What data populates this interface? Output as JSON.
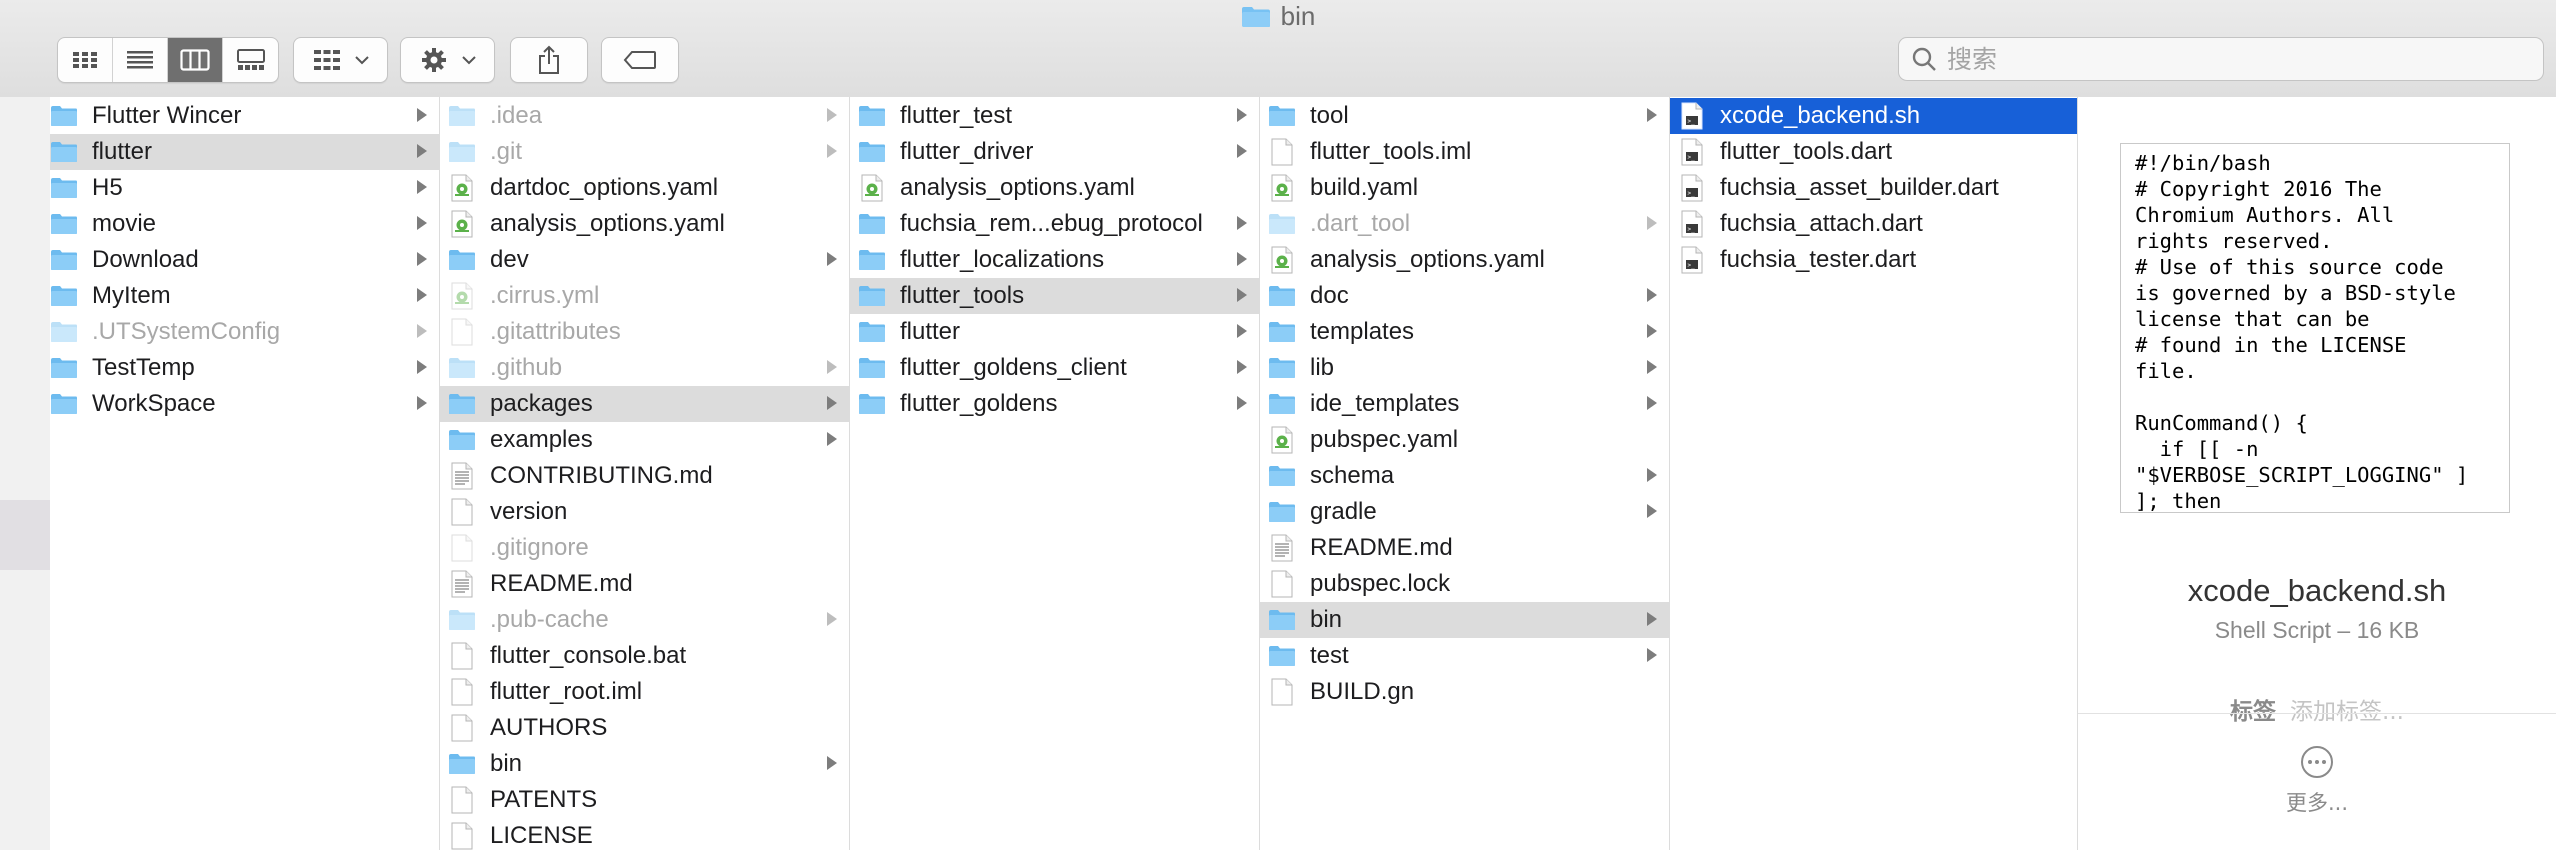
{
  "window": {
    "title": "bin"
  },
  "toolbar": {
    "view_modes": [
      {
        "id": "icon",
        "active": false
      },
      {
        "id": "list",
        "active": false
      },
      {
        "id": "column",
        "active": true
      },
      {
        "id": "gallery",
        "active": false
      }
    ],
    "search": {
      "placeholder": "搜索",
      "value": ""
    }
  },
  "columns": [
    {
      "items": [
        {
          "label": "Flutter Wincer",
          "type": "folder",
          "arrow": true
        },
        {
          "label": "flutter",
          "type": "folder",
          "arrow": true,
          "selected": "grey"
        },
        {
          "label": "H5",
          "type": "folder",
          "arrow": true
        },
        {
          "label": "movie",
          "type": "folder",
          "arrow": true
        },
        {
          "label": "Download",
          "type": "folder",
          "arrow": true
        },
        {
          "label": "MyItem",
          "type": "folder",
          "arrow": true
        },
        {
          "label": ".UTSystemConfig",
          "type": "folder",
          "arrow": true,
          "dim": true
        },
        {
          "label": "TestTemp",
          "type": "folder",
          "arrow": true
        },
        {
          "label": "WorkSpace",
          "type": "folder",
          "arrow": true
        }
      ]
    },
    {
      "items": [
        {
          "label": ".idea",
          "type": "folder",
          "arrow": true,
          "dim": true
        },
        {
          "label": ".git",
          "type": "folder",
          "arrow": true,
          "dim": true
        },
        {
          "label": "dartdoc_options.yaml",
          "type": "yaml"
        },
        {
          "label": "analysis_options.yaml",
          "type": "yaml"
        },
        {
          "label": "dev",
          "type": "folder",
          "arrow": true
        },
        {
          "label": ".cirrus.yml",
          "type": "yaml",
          "dim": true
        },
        {
          "label": ".gitattributes",
          "type": "doc",
          "dim": true
        },
        {
          "label": ".github",
          "type": "folder",
          "arrow": true,
          "dim": true
        },
        {
          "label": "packages",
          "type": "folder",
          "arrow": true,
          "selected": "grey"
        },
        {
          "label": "examples",
          "type": "folder",
          "arrow": true
        },
        {
          "label": "CONTRIBUTING.md",
          "type": "text"
        },
        {
          "label": "version",
          "type": "doc"
        },
        {
          "label": ".gitignore",
          "type": "doc",
          "dim": true
        },
        {
          "label": "README.md",
          "type": "text"
        },
        {
          "label": ".pub-cache",
          "type": "folder",
          "arrow": true,
          "dim": true
        },
        {
          "label": "flutter_console.bat",
          "type": "doc"
        },
        {
          "label": "flutter_root.iml",
          "type": "doc"
        },
        {
          "label": "AUTHORS",
          "type": "doc"
        },
        {
          "label": "bin",
          "type": "folder",
          "arrow": true
        },
        {
          "label": "PATENTS",
          "type": "doc"
        },
        {
          "label": "LICENSE",
          "type": "doc"
        }
      ]
    },
    {
      "items": [
        {
          "label": "flutter_test",
          "type": "folder",
          "arrow": true
        },
        {
          "label": "flutter_driver",
          "type": "folder",
          "arrow": true
        },
        {
          "label": "analysis_options.yaml",
          "type": "yaml"
        },
        {
          "label": "fuchsia_rem...ebug_protocol",
          "type": "folder",
          "arrow": true
        },
        {
          "label": "flutter_localizations",
          "type": "folder",
          "arrow": true
        },
        {
          "label": "flutter_tools",
          "type": "folder",
          "arrow": true,
          "selected": "grey"
        },
        {
          "label": "flutter",
          "type": "folder",
          "arrow": true
        },
        {
          "label": "flutter_goldens_client",
          "type": "folder",
          "arrow": true
        },
        {
          "label": "flutter_goldens",
          "type": "folder",
          "arrow": true
        }
      ]
    },
    {
      "items": [
        {
          "label": "tool",
          "type": "folder",
          "arrow": true
        },
        {
          "label": "flutter_tools.iml",
          "type": "doc"
        },
        {
          "label": "build.yaml",
          "type": "yaml"
        },
        {
          "label": ".dart_tool",
          "type": "folder",
          "arrow": true,
          "dim": true
        },
        {
          "label": "analysis_options.yaml",
          "type": "yaml"
        },
        {
          "label": "doc",
          "type": "folder",
          "arrow": true
        },
        {
          "label": "templates",
          "type": "folder",
          "arrow": true
        },
        {
          "label": "lib",
          "type": "folder",
          "arrow": true
        },
        {
          "label": "ide_templates",
          "type": "folder",
          "arrow": true
        },
        {
          "label": "pubspec.yaml",
          "type": "yaml"
        },
        {
          "label": "schema",
          "type": "folder",
          "arrow": true
        },
        {
          "label": "gradle",
          "type": "folder",
          "arrow": true
        },
        {
          "label": "README.md",
          "type": "text"
        },
        {
          "label": "pubspec.lock",
          "type": "doc"
        },
        {
          "label": "bin",
          "type": "folder",
          "arrow": true,
          "selected": "grey"
        },
        {
          "label": "test",
          "type": "folder",
          "arrow": true
        },
        {
          "label": "BUILD.gn",
          "type": "doc"
        }
      ]
    },
    {
      "items": [
        {
          "label": "xcode_backend.sh",
          "type": "script",
          "selected": "blue"
        },
        {
          "label": "flutter_tools.dart",
          "type": "script"
        },
        {
          "label": "fuchsia_asset_builder.dart",
          "type": "script"
        },
        {
          "label": "fuchsia_attach.dart",
          "type": "script"
        },
        {
          "label": "fuchsia_tester.dart",
          "type": "script"
        }
      ]
    }
  ],
  "preview": {
    "code": "#!/bin/bash\n# Copyright 2016 The\nChromium Authors. All\nrights reserved.\n# Use of this source code\nis governed by a BSD-style\nlicense that can be\n# found in the LICENSE\nfile.\n\nRunCommand() {\n  if [[ -n\n\"$VERBOSE_SCRIPT_LOGGING\" ]\n]; then\n    echo \"♦ $*\"",
    "file_name": "xcode_backend.sh",
    "file_info": "Shell Script – 16 KB",
    "tags_label": "标签",
    "tags_placeholder": "添加标签...",
    "more_label": "更多..."
  }
}
